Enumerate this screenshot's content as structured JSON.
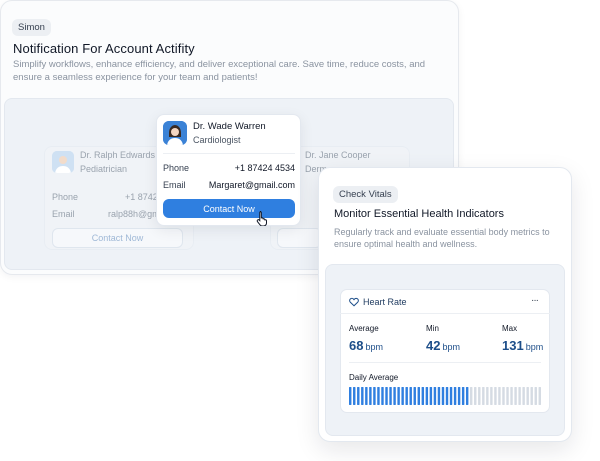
{
  "left_card": {
    "tag": "Simon",
    "title": "Notification For Account Actifity",
    "description": "Simplify workflows, enhance efficiency, and deliver exceptional care. Save time, reduce costs, and ensure a seamless experience for your team and patients!",
    "contacts": {
      "left": {
        "name": "Dr.  Ralph Edwards",
        "role": "Pediatrician",
        "phone_label": "Phone",
        "phone_value": "+1 87424",
        "email_label": "Email",
        "email_value": "ralp88h@gm",
        "button_label": "Contact Now"
      },
      "center": {
        "name": "Dr.  Wade Warren",
        "role": "Cardiologist",
        "phone_label": "Phone",
        "phone_value": "+1 87424 4534",
        "email_label": "Email",
        "email_value": "Margaret@gmail.com",
        "button_label": "Contact Now"
      },
      "right": {
        "name": "Dr.  Jane Cooper",
        "role": "Derm"
      }
    }
  },
  "right_card": {
    "tag": "Check Vitals",
    "title": "Monitor Essential Health Indicators",
    "description": "Regularly track and evaluate essential body metrics to ensure optimal health and wellness.",
    "heart_rate": {
      "title": "Heart Rate",
      "more": "···",
      "average_label": "Average",
      "average_value": "68",
      "min_label": "Min",
      "min_value": "42",
      "max_label": "Max",
      "max_value": "131",
      "unit": "bpm",
      "daily_label": "Daily Average",
      "daily_progress": 0.62
    }
  },
  "colors": {
    "accent": "#2f7fe0",
    "bar_filled": "#2f7fe0",
    "bar_empty": "#d5dbe3",
    "value_text": "#1d4e89"
  }
}
